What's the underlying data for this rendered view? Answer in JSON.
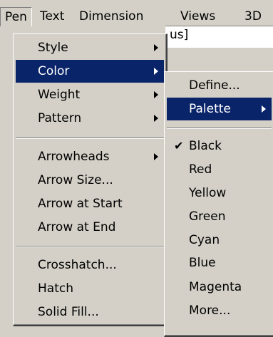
{
  "menubar": [
    "Pen",
    "Text",
    "Dimension",
    "Views",
    "3D"
  ],
  "background_field_text": "us]",
  "pen_menu": {
    "items": [
      "Style",
      "Color",
      "Weight",
      "Pattern",
      "Arrowheads",
      "Arrow Size...",
      "Arrow at Start",
      "Arrow at End",
      "Crosshatch...",
      "Hatch",
      "Solid Fill..."
    ],
    "submenu_items": [
      "Style",
      "Color",
      "Weight",
      "Pattern",
      "Arrowheads"
    ],
    "highlighted": "Color"
  },
  "color_menu": {
    "items": [
      "Define...",
      "Palette"
    ],
    "highlighted": "Palette",
    "colors": [
      "Black",
      "Red",
      "Yellow",
      "Green",
      "Cyan",
      "Blue",
      "Magenta",
      "More..."
    ],
    "checked": "Black"
  },
  "colors": {
    "highlight": "#0a246a",
    "menu_bg": "#d4d0c8"
  }
}
